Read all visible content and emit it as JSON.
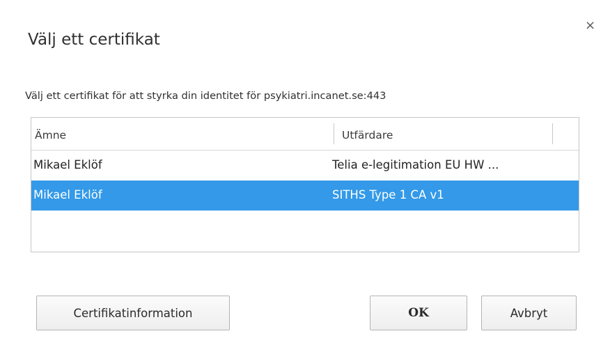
{
  "dialog": {
    "title": "Välj ett certifikat",
    "subtitle": "Välj ett certifikat för att styrka din identitet för psykiatri.incanet.se:443",
    "close_glyph": "×"
  },
  "table": {
    "columns": [
      "Ämne",
      "Utfärdare"
    ],
    "rows": [
      {
        "subject": "Mikael Eklöf",
        "issuer": "Telia e-legitimation EU HW ..."
      },
      {
        "subject": "Mikael Eklöf",
        "issuer": "SITHS Type 1 CA v1",
        "selected": true
      }
    ]
  },
  "buttons": {
    "info": "Certifikatinformation",
    "ok": "OK",
    "cancel": "Avbryt"
  },
  "colors": {
    "selection": "#3399e8",
    "text": "#303030"
  }
}
